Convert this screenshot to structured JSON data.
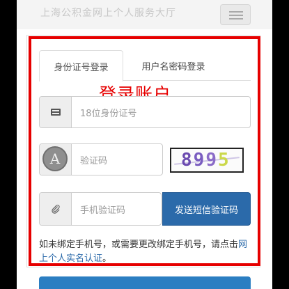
{
  "header": {
    "title": "上海公积金网上个人服务大厅"
  },
  "tabs": [
    {
      "label": "身份证号登录",
      "active": true
    },
    {
      "label": "用户名密码登录",
      "active": false
    }
  ],
  "annotation": {
    "label": "登录账户",
    "color": "#e60000"
  },
  "form": {
    "id_placeholder": "18位身份证号",
    "code_placeholder": "验证码",
    "captcha_avatar_letter": "A",
    "captcha_digits": [
      "8",
      "9",
      "9",
      "5"
    ],
    "sms_placeholder": "手机验证码",
    "sms_button": "发送短信验证码"
  },
  "note": {
    "text_before": "如未绑定手机号，或需要更改绑定手机号，请点击",
    "link": "网上个人实名认证",
    "text_after": "。"
  },
  "colors": {
    "primary": "#2b6aaa",
    "highlight": "#e60000"
  },
  "icons": [
    "menu-icon",
    "id-card-icon",
    "captcha-avatar-icon",
    "paperclip-icon"
  ]
}
